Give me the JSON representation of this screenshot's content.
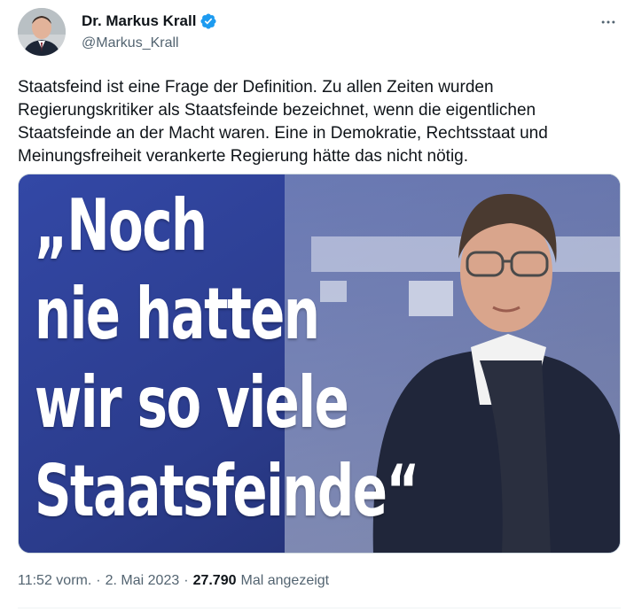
{
  "author": {
    "name": "Dr. Markus Krall",
    "handle": "@Markus_Krall",
    "verified": true,
    "verified_color": "#1d9bf0"
  },
  "icons": {
    "more": "more-options-icon",
    "verified": "verified-badge-icon",
    "avatar": "avatar"
  },
  "tweet": {
    "text": "Staatsfeind ist eine Frage der Definition. Zu allen Zeiten wurden Regierungskritiker als Staatsfeinde bezeichnet, wenn die eigentlichen Staatsfeinde an der Macht waren. Eine in Demokratie, Rechtsstaat und Meinungsfreiheit verankerte Regierung hätte das nicht nötig."
  },
  "media": {
    "headline_lines": [
      "„Noch",
      "nie hatten",
      "wir so viele",
      "Staatsfeinde“"
    ],
    "background_color": "#2c3d8f"
  },
  "meta": {
    "time": "11:52 vorm.",
    "separator": "·",
    "date": "2. Mai 2023",
    "views_count": "27.790",
    "views_label": "Mal angezeigt"
  }
}
